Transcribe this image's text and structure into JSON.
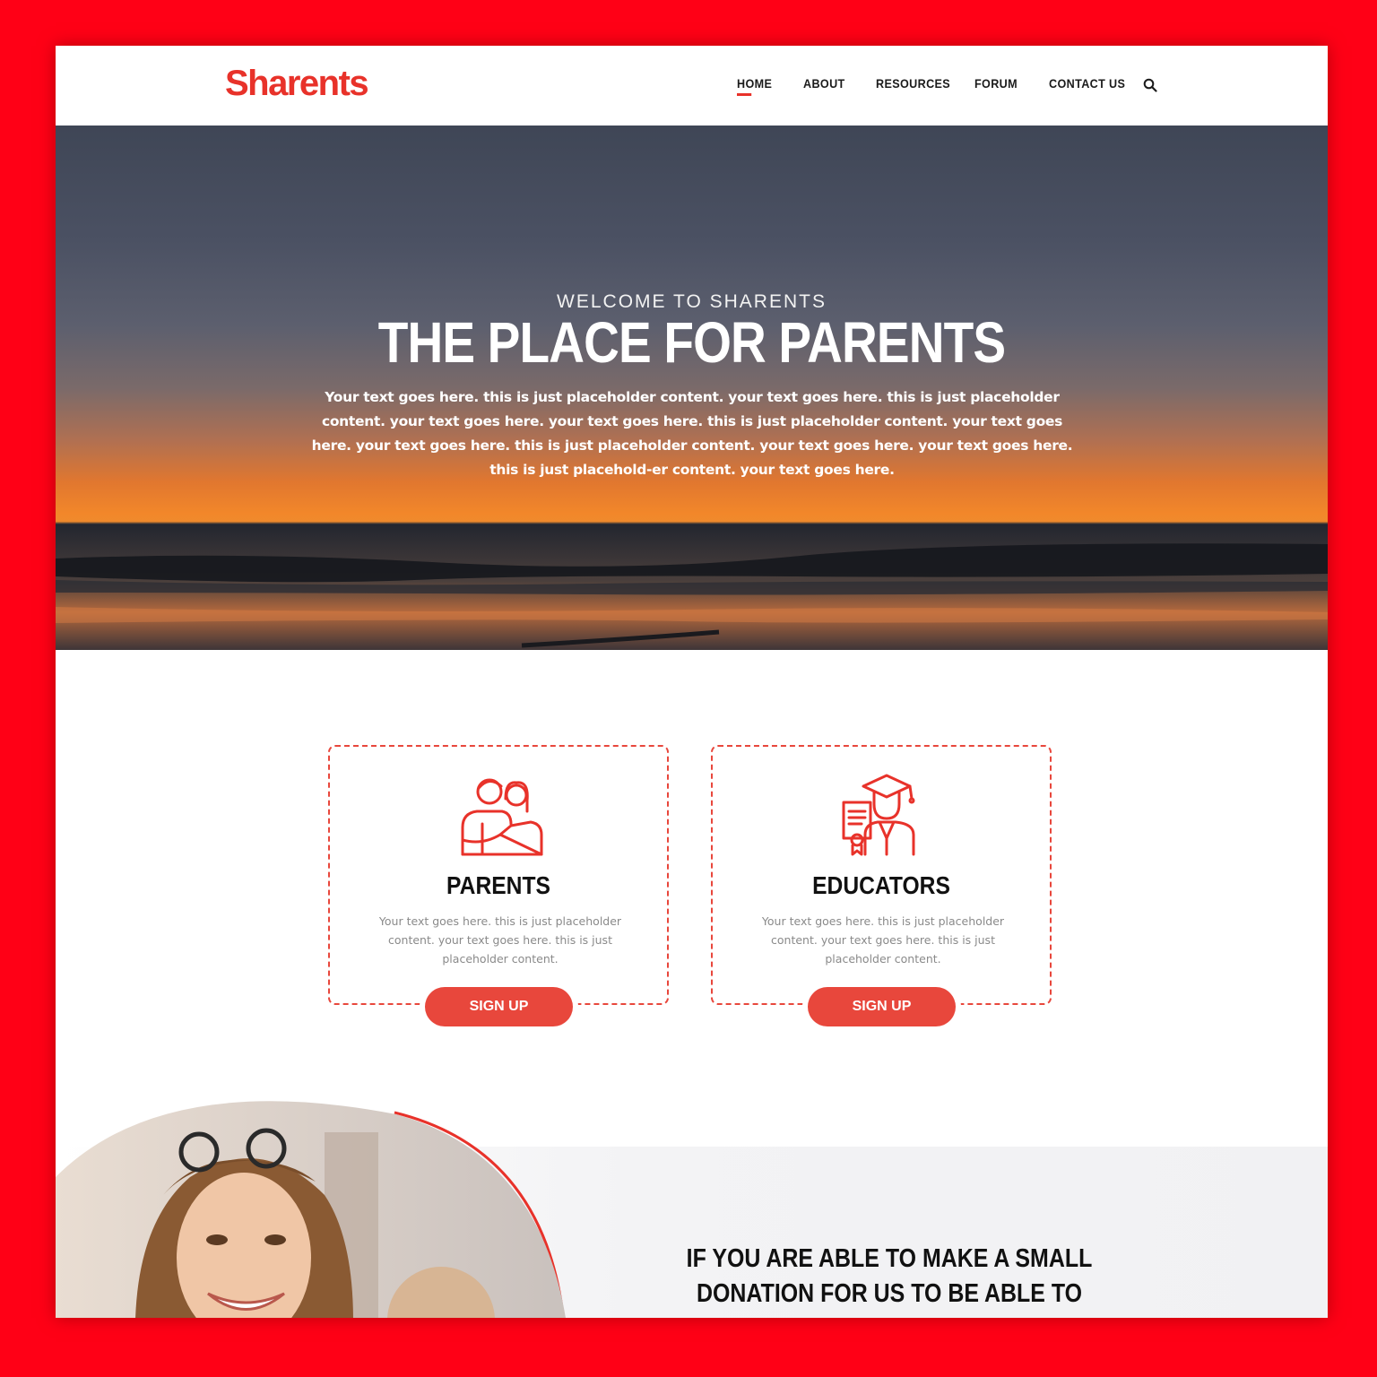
{
  "brand": {
    "logo_text": "Sharents",
    "accent_color": "#e8322a",
    "frame_color": "#ff0016"
  },
  "nav": {
    "items": [
      {
        "label": "HOME",
        "active": true
      },
      {
        "label": "ABOUT",
        "active": false
      },
      {
        "label": "RESOURCES",
        "active": false
      },
      {
        "label": "FORUM",
        "active": false
      },
      {
        "label": "CONTACT US",
        "active": false
      }
    ],
    "search_icon": "search-icon"
  },
  "hero": {
    "kicker": "WELCOME TO SHARENTS",
    "title": "THE PLACE FOR PARENTS",
    "body": "Your text goes here. this is just placeholder content. your text goes here. this is just placeholder content. your text goes here. your text goes here. this is just placeholder content. your text goes here. your text goes here. this is just placeholder content. your text goes here. your text goes here. this is just placehold-er content. your text goes here."
  },
  "cards": [
    {
      "icon": "parents-icon",
      "title": "PARENTS",
      "body": "Your text goes here. this is just placeholder content. your text goes here. this is just placeholder content.",
      "button_label": "SIGN UP"
    },
    {
      "icon": "graduate-icon",
      "title": "EDUCATORS",
      "body": "Your text goes here. this is just placeholder content. your text goes here. this is just placeholder content.",
      "button_label": "SIGN UP"
    }
  ],
  "donation": {
    "heading": "IF YOU ARE ABLE TO MAKE A SMALL DONATION FOR US TO BE ABLE TO EXPAND SERVICES TO THE"
  }
}
